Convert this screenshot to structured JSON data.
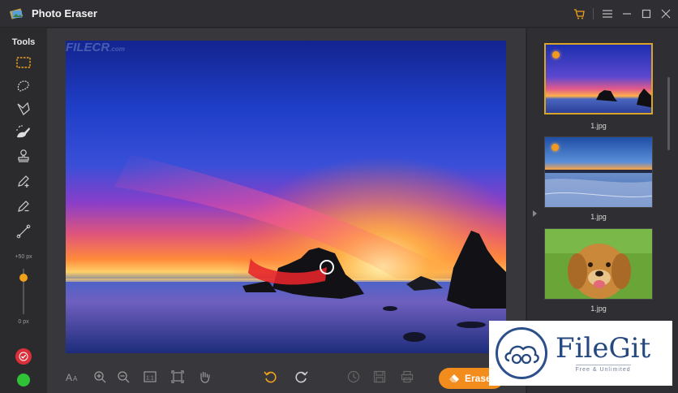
{
  "app": {
    "title": "Photo Eraser"
  },
  "window_controls": [
    {
      "name": "cart-icon"
    },
    {
      "name": "menu-icon"
    },
    {
      "name": "minimize-icon"
    },
    {
      "name": "maximize-icon"
    },
    {
      "name": "close-icon"
    }
  ],
  "tools": {
    "label": "Tools",
    "items": [
      {
        "name": "rectangle-select-icon"
      },
      {
        "name": "lasso-icon"
      },
      {
        "name": "polygon-lasso-icon"
      },
      {
        "name": "smart-brush-icon"
      },
      {
        "name": "stamp-icon"
      },
      {
        "name": "brush-plus-icon"
      },
      {
        "name": "brush-minus-icon"
      },
      {
        "name": "line-icon"
      }
    ],
    "brush_size_max": "+50 px",
    "brush_size_min": "0 px",
    "brush_size_level": 0.8
  },
  "canvas": {
    "watermark": "FILECR",
    "watermark_suffix": ".com"
  },
  "bottom_toolbar": {
    "items": [
      "text-size-icon",
      "zoom-in-icon",
      "zoom-out-icon",
      "actual-size-icon",
      "fit-icon",
      "hand-icon",
      "undo-icon",
      "redo-icon",
      "history-icon",
      "save-icon",
      "print-icon"
    ],
    "erase_label": "Erase"
  },
  "thumbnails": [
    {
      "label": "1.jpg",
      "selected": true
    },
    {
      "label": "1.jpg",
      "selected": false
    },
    {
      "label": "1.jpg",
      "selected": false
    }
  ],
  "badge": {
    "name": "FileGit",
    "tagline": "Free & Unlimited"
  },
  "colors": {
    "accent": "#f28c1c",
    "selected_border": "#d9a428",
    "confirm": "#d9303a",
    "green": "#2fc237"
  }
}
